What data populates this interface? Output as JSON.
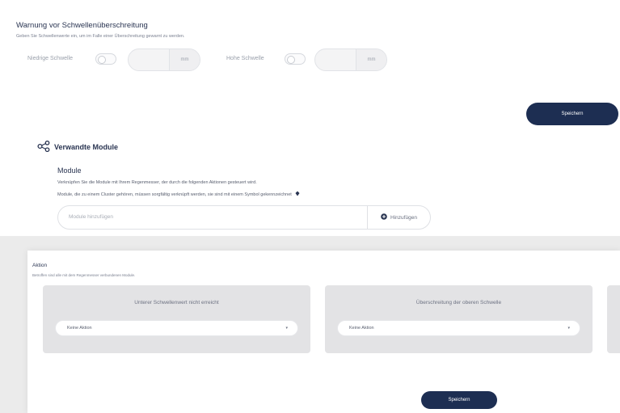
{
  "threshold": {
    "title": "Warnung vor Schwellenüberschreitung",
    "subtitle": "Geben Sie Schwellenwerte ein, um im Falle einer Überschreitung gewarnt zu werden.",
    "low_label": "Niedrige Schwelle",
    "high_label": "Hohe Schwelle",
    "unit": "mm",
    "save_label": "Speichern"
  },
  "modules": {
    "section_title": "Verwandte Module",
    "subheading": "Module",
    "desc1": "Verknüpfen Sie die Module mit Ihrem Regenmesser, der durch die folgenden Aktionen gesteuert wird.",
    "desc2": "Module, die zu einem Cluster gehören, müssen sorgfältig verknüpft werden, sie sind mit einem Symbol gekennzeichnet",
    "input_placeholder": "Module hinzufügen",
    "add_label": "Hinzufügen"
  },
  "aktion": {
    "title": "Aktion",
    "subtitle": "Betroffen sind alle mit dem Regenmesser verbundenen Module.",
    "cards": [
      {
        "title": "Unterer Schwellenwert nicht erreicht",
        "select": "Keine Aktion"
      },
      {
        "title": "Überschreitung der oberen Schwelle",
        "select": "Keine Aktion"
      }
    ],
    "save_label": "Speichern"
  },
  "colors": {
    "primary": "#1d2e52",
    "background": "#ebebeb",
    "card": "#e3e3e5"
  }
}
